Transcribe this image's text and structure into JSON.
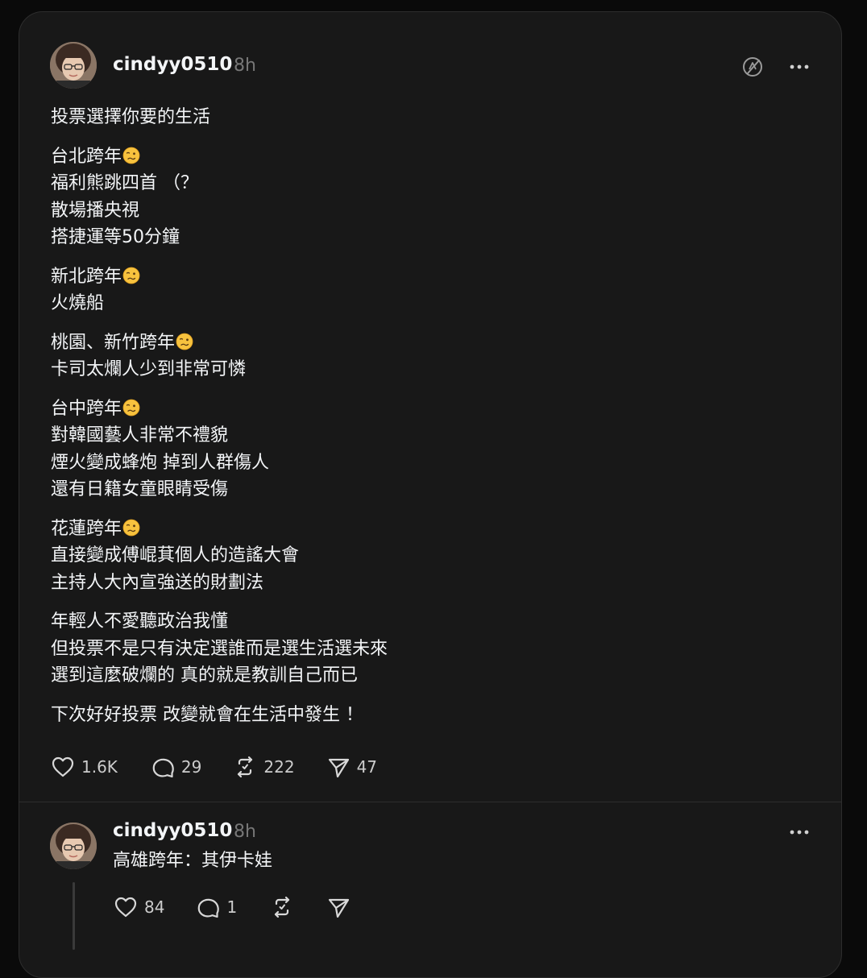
{
  "post": {
    "username": "cindyy0510",
    "time": "8h",
    "paragraphs": [
      {
        "lines": [
          {
            "text": "投票選擇你要的生活",
            "emoji": false
          }
        ]
      },
      {
        "lines": [
          {
            "text": "台北跨年",
            "emoji": true
          },
          {
            "text": "福利熊跳四首 （？",
            "emoji": false
          },
          {
            "text": "散場播央視",
            "emoji": false
          },
          {
            "text": "搭捷運等50分鐘",
            "emoji": false
          }
        ]
      },
      {
        "lines": [
          {
            "text": "新北跨年",
            "emoji": true
          },
          {
            "text": "火燒船",
            "emoji": false
          }
        ]
      },
      {
        "lines": [
          {
            "text": "桃園、新竹跨年",
            "emoji": true
          },
          {
            "text": "卡司太爛人少到非常可憐",
            "emoji": false
          }
        ]
      },
      {
        "lines": [
          {
            "text": "台中跨年",
            "emoji": true
          },
          {
            "text": "對韓國藝人非常不禮貌",
            "emoji": false
          },
          {
            "text": "煙火變成蜂炮 掉到人群傷人",
            "emoji": false
          },
          {
            "text": "還有日籍女童眼睛受傷",
            "emoji": false
          }
        ]
      },
      {
        "lines": [
          {
            "text": "花蓮跨年",
            "emoji": true
          },
          {
            "text": "直接變成傅崐萁個人的造謠大會",
            "emoji": false
          },
          {
            "text": "主持人大內宣強送的財劃法",
            "emoji": false
          }
        ]
      },
      {
        "lines": [
          {
            "text": "年輕人不愛聽政治我懂",
            "emoji": false
          },
          {
            "text": "但投票不是只有決定選誰而是選生活選未來",
            "emoji": false
          },
          {
            "text": "選到這麼破爛的 真的就是教訓自己而已",
            "emoji": false
          }
        ]
      },
      {
        "lines": [
          {
            "text": "下次好好投票 改變就會在生活中發生 ！",
            "emoji": false
          }
        ]
      }
    ],
    "likes": "1.6K",
    "comments": "29",
    "reposts": "222",
    "shares": "47"
  },
  "reply": {
    "username": "cindyy0510",
    "time": "8h",
    "text": "高雄跨年：其伊卡娃",
    "likes": "84",
    "comments": "1"
  },
  "icons": {
    "post_header_left": "no-translate-icon",
    "more": "more-dots-icon",
    "like": "heart-icon",
    "comment": "comment-bubble-icon",
    "repost": "repost-icon",
    "share": "send-icon",
    "emoji": "woozy-face-emoji"
  },
  "colors": {
    "background": "#0a0a0a",
    "card": "#181818",
    "text": "#f3f5f7",
    "muted": "#777777",
    "border": "#2d2d2d"
  }
}
